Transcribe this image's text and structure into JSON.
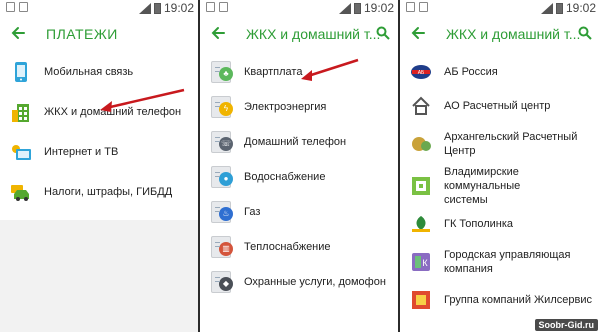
{
  "status_time": "19:02",
  "screens": [
    {
      "title": "ПЛАТЕЖИ",
      "items": [
        {
          "label": "Мобильная связь",
          "icon": "phone-icon"
        },
        {
          "label": "ЖКХ и домашний телефон",
          "icon": "building-icon"
        },
        {
          "label": "Интернет и ТВ",
          "icon": "tv-icon"
        },
        {
          "label": "Налоги, штрафы, ГИБДД",
          "icon": "car-icon"
        }
      ]
    },
    {
      "title": "ЖКХ и домашний т...",
      "items": [
        {
          "label": "Квартплата",
          "icon": "tree-icon",
          "color": "#5cb85c"
        },
        {
          "label": "Электроэнергия",
          "icon": "lightning-icon",
          "color": "#f0b400"
        },
        {
          "label": "Домашний телефон",
          "icon": "phone-handset-icon",
          "color": "#5b6470"
        },
        {
          "label": "Водоснабжение",
          "icon": "water-drop-icon",
          "color": "#2e9fd6"
        },
        {
          "label": "Газ",
          "icon": "flame-icon",
          "color": "#2f6fd1"
        },
        {
          "label": "Теплоснабжение",
          "icon": "heater-icon",
          "color": "#d4553c"
        },
        {
          "label": "Охранные услуги, домофон",
          "icon": "shield-icon",
          "color": "#4a4f57"
        }
      ]
    },
    {
      "title": "ЖКХ и домашний т...",
      "items": [
        {
          "label": "АБ Россия",
          "icon": "ab-russia-logo-icon",
          "color": "#1f3d8a"
        },
        {
          "label": "АО Расчетный центр",
          "icon": "house-logo-icon",
          "color": "#555555"
        },
        {
          "label": "Архангельский Расчетный Центр",
          "label_line1": "Архангельский Расчетный",
          "label_line2": "Центр",
          "icon": "arkhangelsk-logo-icon",
          "color": "#c9a23a"
        },
        {
          "label": "Владимирские коммунальные системы",
          "label_line1": "Владимирские коммунальные",
          "label_line2": "системы",
          "icon": "vladimir-logo-icon",
          "color": "#7ac143"
        },
        {
          "label": "ГК Тополинка",
          "icon": "topolinka-logo-icon",
          "color": "#2e8b3a"
        },
        {
          "label": "Городская управляющая компания",
          "label_line1": "Городская управляющая",
          "label_line2": "компания",
          "icon": "guk-logo-icon",
          "color": "#8a6cc2"
        },
        {
          "label": "Группа компаний Жилсервис",
          "icon": "zhilservis-logo-icon",
          "color": "#e04a2e"
        }
      ]
    }
  ],
  "watermark": "Soobr-Gid.ru",
  "accent_color": "#2e9d36"
}
